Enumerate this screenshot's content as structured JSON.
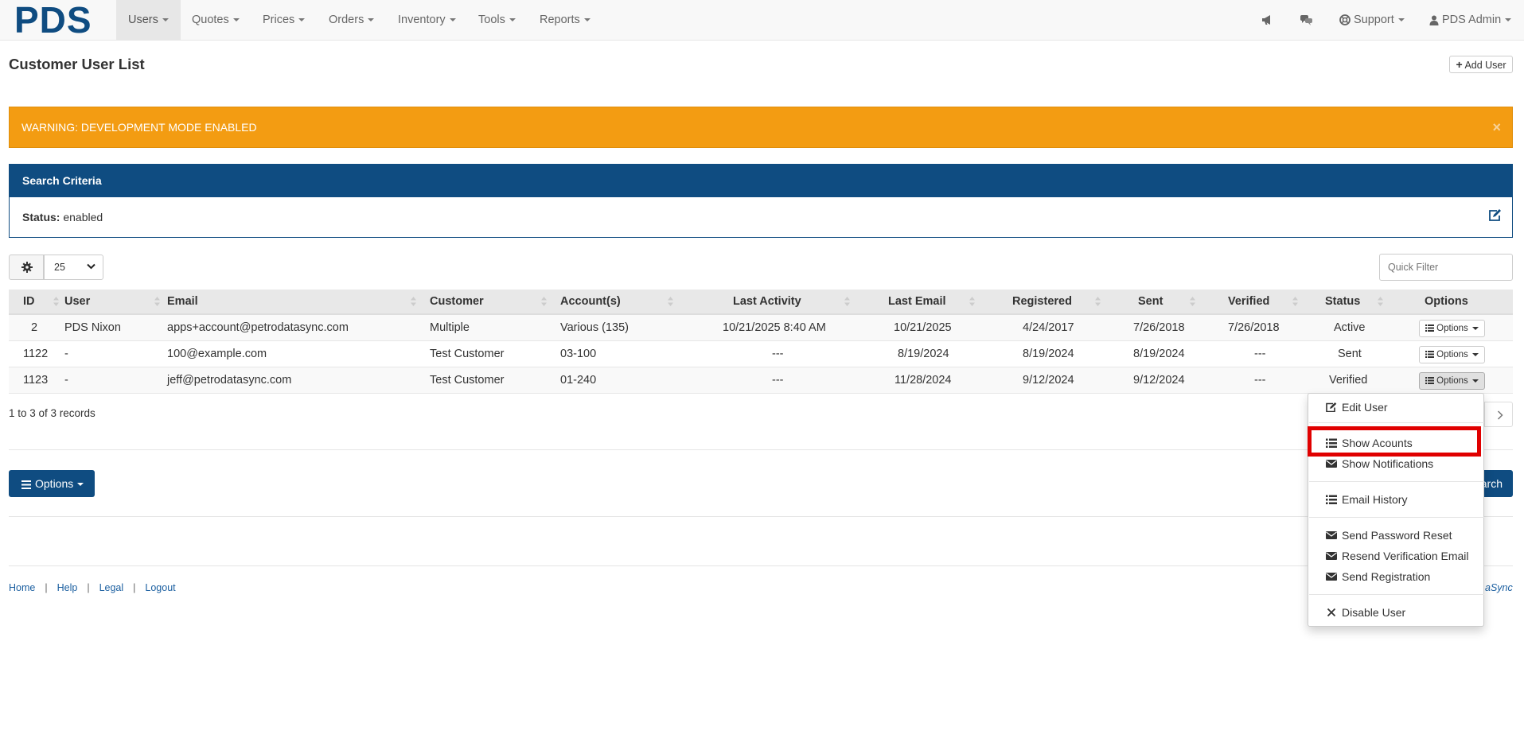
{
  "brand": {
    "logo": "PDS",
    "color": "#0f4c81"
  },
  "nav": {
    "left": [
      {
        "label": "Users",
        "active": true
      },
      {
        "label": "Quotes"
      },
      {
        "label": "Prices"
      },
      {
        "label": "Orders"
      },
      {
        "label": "Inventory"
      },
      {
        "label": "Tools"
      },
      {
        "label": "Reports"
      }
    ],
    "right": {
      "announce_icon": "megaphone-icon",
      "chat_icon": "comments-icon",
      "support": "Support",
      "user": "PDS Admin"
    }
  },
  "page": {
    "title": "Customer User List",
    "add_user": "Add User"
  },
  "alert": {
    "text": "WARNING: DEVELOPMENT MODE ENABLED",
    "close": "×",
    "color": "#f39c12"
  },
  "search_criteria": {
    "title": "Search Criteria",
    "status_label": "Status:",
    "status_value": "enabled"
  },
  "toolbar": {
    "page_size": "25",
    "quick_filter_placeholder": "Quick Filter"
  },
  "table": {
    "columns": [
      "ID",
      "User",
      "Email",
      "Customer",
      "Account(s)",
      "Last Activity",
      "Last Email",
      "Registered",
      "Sent",
      "Verified",
      "Status",
      "Options"
    ],
    "rows": [
      {
        "id": "2",
        "user": "PDS Nixon",
        "email": "apps+account@petrodatasync.com",
        "customer": "Multiple",
        "accounts": "Various (135)",
        "last_activity": "10/21/2025 8:40 AM",
        "last_email": "10/21/2025",
        "registered": "4/24/2017",
        "sent": "7/26/2018",
        "verified": "7/26/2018",
        "status": "Active",
        "options": "Options"
      },
      {
        "id": "1122",
        "user": "-",
        "email": "100@example.com",
        "customer": "Test Customer",
        "accounts": "03-100",
        "last_activity": "---",
        "last_email": "8/19/2024",
        "registered": "8/19/2024",
        "sent": "8/19/2024",
        "verified": "---",
        "status": "Sent",
        "options": "Options"
      },
      {
        "id": "1123",
        "user": "-",
        "email": "jeff@petrodatasync.com",
        "customer": "Test Customer",
        "accounts": "01-240",
        "last_activity": "---",
        "last_email": "11/28/2024",
        "registered": "9/12/2024",
        "sent": "9/12/2024",
        "verified": "---",
        "status": "Verified",
        "options": "Options"
      }
    ],
    "records": "1 to 3 of 3 records"
  },
  "bottom": {
    "options": "Options",
    "search_fragment": "arch"
  },
  "footer": {
    "links": [
      "Home",
      "Help",
      "Legal",
      "Logout"
    ],
    "right_fragment": "aSync"
  },
  "dropdown": {
    "items": [
      {
        "label": "Edit User",
        "icon": "edit-icon"
      },
      {
        "label": "Show Acounts",
        "icon": "list-icon"
      },
      {
        "label": "Show Notifications",
        "icon": "envelope-icon"
      },
      {
        "label": "Email History",
        "icon": "list-icon"
      },
      {
        "label": "Send Password Reset",
        "icon": "envelope-icon"
      },
      {
        "label": "Resend Verification Email",
        "icon": "envelope-icon"
      },
      {
        "label": "Send Registration",
        "icon": "envelope-icon"
      },
      {
        "label": "Disable User",
        "icon": "times-icon"
      }
    ],
    "highlight_color": "#e00000"
  }
}
